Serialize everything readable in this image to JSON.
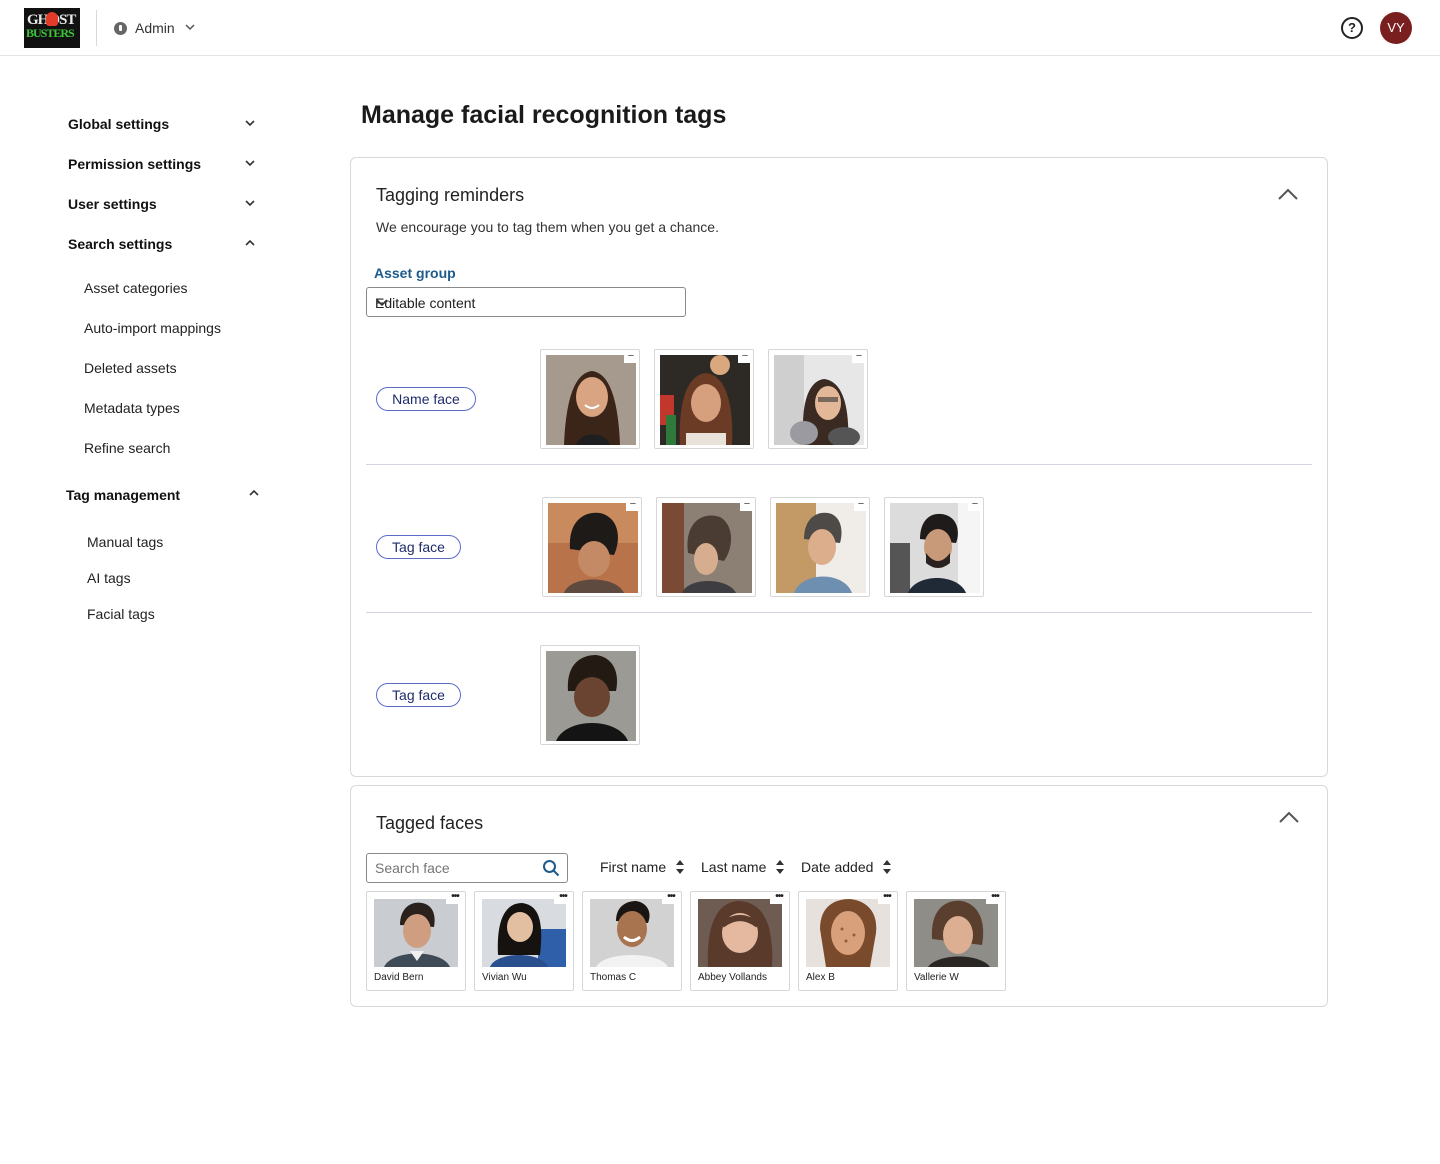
{
  "topbar": {
    "logo_line1": "GHOST",
    "logo_line2": "BUSTERS",
    "workspace": "Admin",
    "help": "?",
    "user_initials": "VY"
  },
  "sidebar": {
    "sections": [
      {
        "label": "Global settings",
        "expanded": false
      },
      {
        "label": "Permission settings",
        "expanded": false
      },
      {
        "label": "User settings",
        "expanded": false
      },
      {
        "label": "Search settings",
        "expanded": true,
        "items": [
          "Asset categories",
          "Auto-import mappings",
          "Deleted assets",
          "Metadata types",
          "Refine search"
        ]
      },
      {
        "label": "Tag management",
        "expanded": true,
        "items": [
          "Manual tags",
          "AI tags",
          "Facial tags"
        ]
      }
    ]
  },
  "main": {
    "title": "Manage facial recognition tags",
    "reminders": {
      "title": "Tagging reminders",
      "subtitle": "We encourage you to tag them when you get a chance.",
      "asset_group_label": "Asset group",
      "asset_group_value": "Editable content",
      "groups": [
        {
          "action": "Name face",
          "face_count": 3
        },
        {
          "action": "Tag face",
          "face_count": 4
        },
        {
          "action": "Tag face",
          "face_count": 1
        }
      ],
      "remove_glyph": "−"
    },
    "tagged": {
      "title": "Tagged faces",
      "search_placeholder": "Search face",
      "sort_columns": [
        "First name",
        "Last name",
        "Date added"
      ],
      "more_glyph": "•••",
      "people": [
        "David Bern",
        "Vivian Wu",
        "Thomas C",
        "Abbey Vollands",
        "Alex B",
        "Vallerie W"
      ]
    }
  },
  "colors": {
    "accent_link": "#1d5b8c",
    "pill_border": "#5b6cc9",
    "avatar_bg": "#7a1f1f"
  }
}
